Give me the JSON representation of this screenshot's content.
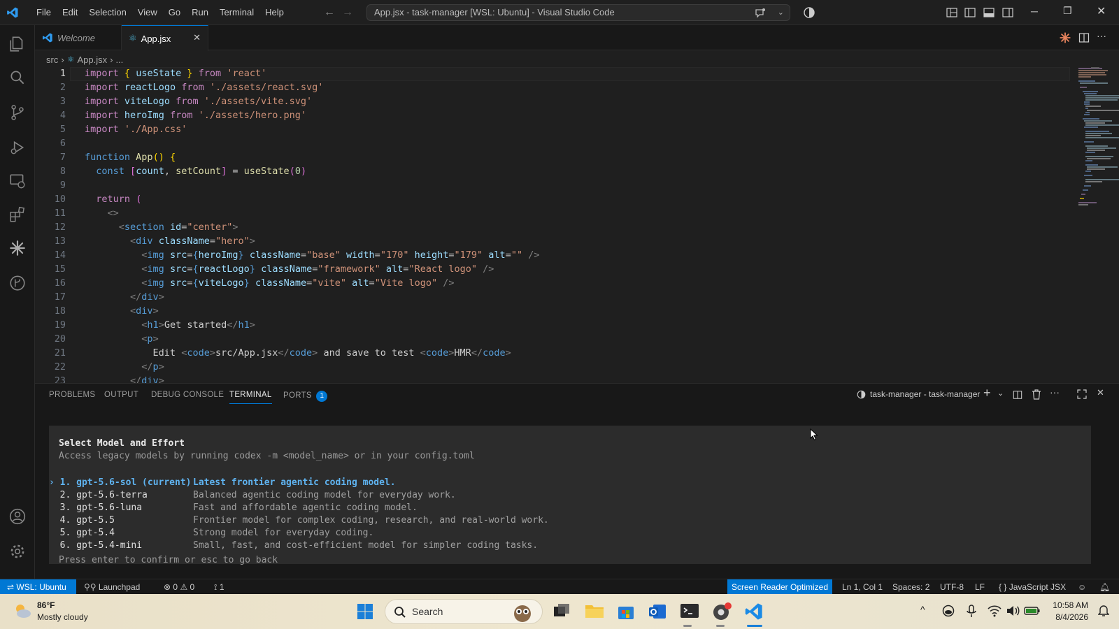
{
  "titlebar": {
    "menus": [
      "File",
      "Edit",
      "Selection",
      "View",
      "Go",
      "Run",
      "Terminal",
      "Help"
    ],
    "window_title": "App.jsx - task-manager [WSL: Ubuntu] - Visual Studio Code"
  },
  "tabs": [
    {
      "label": "Welcome",
      "icon": "vscode-icon"
    },
    {
      "label": "App.jsx",
      "icon": "react-icon"
    }
  ],
  "breadcrumb": {
    "folder": "src",
    "file": "App.jsx",
    "more": "..."
  },
  "editor": {
    "line_numbers": [
      "1",
      "2",
      "3",
      "4",
      "5",
      "6",
      "7",
      "8",
      "9",
      "10",
      "11",
      "12",
      "13",
      "14",
      "15",
      "16",
      "17",
      "18",
      "19",
      "20",
      "21",
      "22",
      "23"
    ]
  },
  "panel": {
    "tabs": [
      "PROBLEMS",
      "OUTPUT",
      "DEBUG CONSOLE",
      "TERMINAL",
      "PORTS"
    ],
    "ports_badge": "1",
    "terminal_name": "task-manager - task-manager"
  },
  "terminal": {
    "heading": "Select Model and Effort",
    "subheading": "Access legacy models by running codex -m <model_name> or in your config.toml",
    "options": [
      {
        "label": "› 1. gpt-5.6-sol (current)",
        "desc": "Latest frontier agentic coding model."
      },
      {
        "label": "  2. gpt-5.6-terra",
        "desc": "Balanced agentic coding model for everyday work."
      },
      {
        "label": "  3. gpt-5.6-luna",
        "desc": "Fast and affordable agentic coding model."
      },
      {
        "label": "  4. gpt-5.5",
        "desc": "Frontier model for complex coding, research, and real-world work."
      },
      {
        "label": "  5. gpt-5.4",
        "desc": "Strong model for everyday coding."
      },
      {
        "label": "  6. gpt-5.4-mini",
        "desc": "Small, fast, and cost-efficient model for simpler coding tasks."
      }
    ],
    "footer": "Press enter to confirm or esc to go back"
  },
  "statusbar": {
    "remote": "WSL: Ubuntu",
    "launchpad": "Launchpad",
    "errors": "0",
    "warnings": "0",
    "ports": "1",
    "screen_reader": "Screen Reader Optimized",
    "position": "Ln 1, Col 1",
    "spaces": "Spaces: 2",
    "encoding": "UTF-8",
    "eol": "LF",
    "language": "JavaScript JSX"
  },
  "taskbar": {
    "temperature": "86°F",
    "weather": "Mostly cloudy",
    "search_placeholder": "Search",
    "time": "10:58 AM",
    "date": "8/4/2026"
  },
  "colors": {
    "accent": "#0078d4",
    "statusbar_remote": "#0078d4",
    "selected_option": "#5fb3f0"
  }
}
